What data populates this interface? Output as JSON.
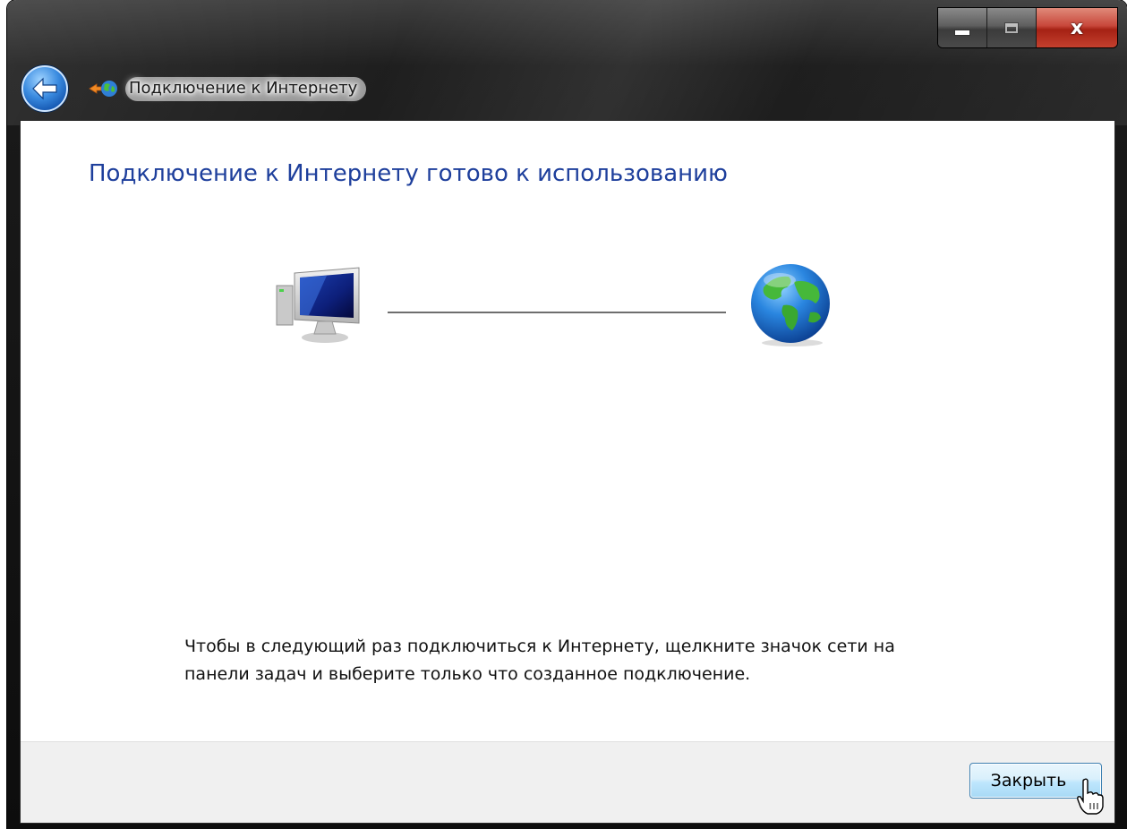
{
  "window": {
    "title": "Подключение к Интернету"
  },
  "caption": {
    "minimize_icon": "minimize-icon",
    "maximize_icon": "maximize-icon",
    "close_glyph": "x"
  },
  "content": {
    "heading": "Подключение к Интернету готово к использованию",
    "instruction_line1": "Чтобы в следующий раз подключиться к Интернету, щелкните значок сети на",
    "instruction_line2": "панели задач и выберите только что созданное подключение."
  },
  "footer": {
    "close_label": "Закрыть"
  },
  "colors": {
    "heading": "#1e3f9c",
    "button_border": "#3c7fb1"
  }
}
